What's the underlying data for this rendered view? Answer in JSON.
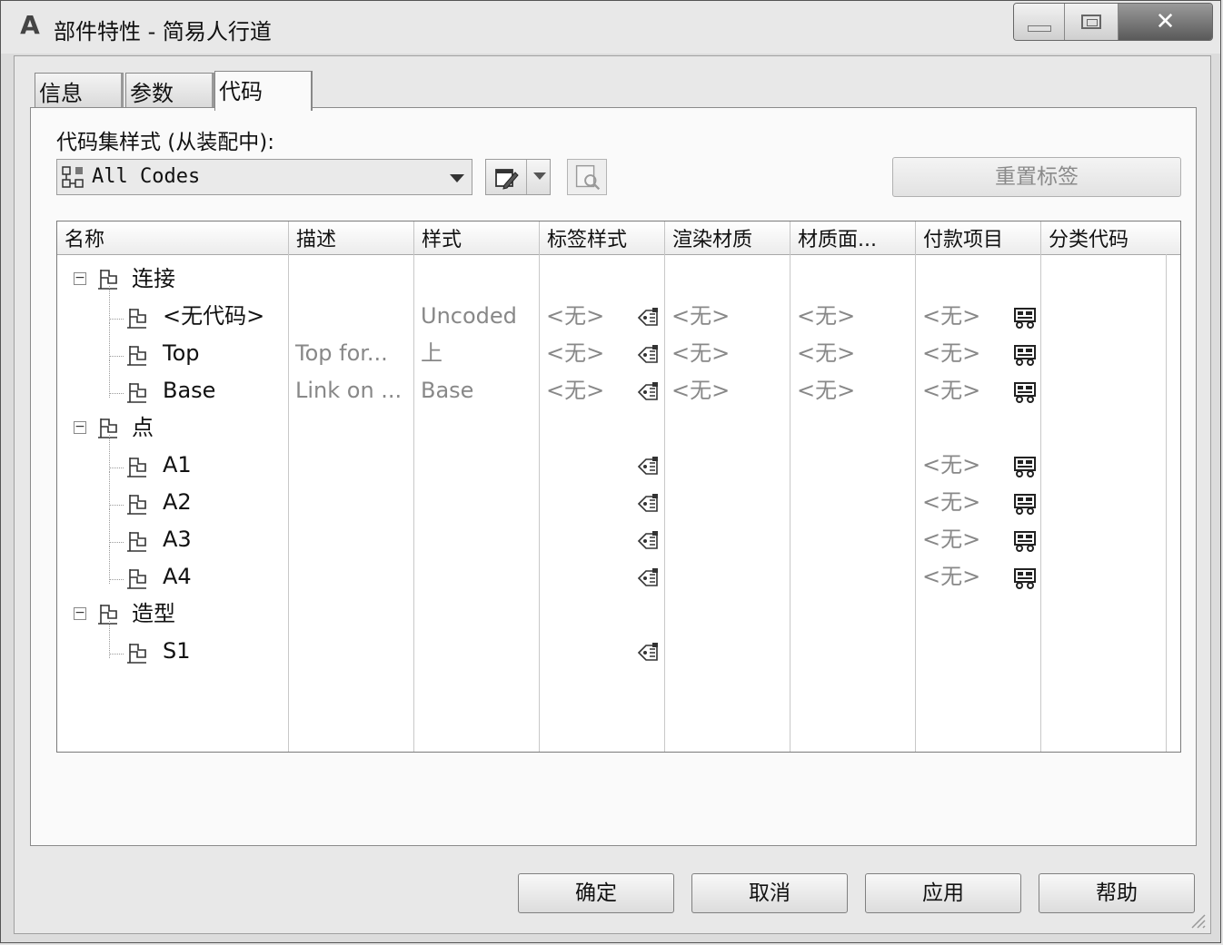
{
  "window": {
    "title": "部件特性 - 简易人行道",
    "app_icon_letter": "A"
  },
  "tabs": [
    {
      "label": "信息",
      "active": false
    },
    {
      "label": "参数",
      "active": false
    },
    {
      "label": "代码",
      "active": true
    }
  ],
  "code_set": {
    "label": "代码集样式 (从装配中):",
    "selected": "All Codes",
    "reset_labels_button": "重置标签"
  },
  "grid": {
    "columns": [
      "名称",
      "描述",
      "样式",
      "标签样式",
      "渲染材质",
      "材质面...",
      "付款项目",
      "分类代码"
    ],
    "rows": [
      {
        "level": 0,
        "name": "连接",
        "expanded": true
      },
      {
        "level": 1,
        "name": "<无代码>",
        "description": "",
        "style": "Uncoded",
        "label_style": "<无>",
        "render_material": "<无>",
        "material_area": "<无>",
        "pay_item": "<无>"
      },
      {
        "level": 1,
        "name": "Top",
        "description": "Top for...",
        "style": "上",
        "label_style": "<无>",
        "render_material": "<无>",
        "material_area": "<无>",
        "pay_item": "<无>"
      },
      {
        "level": 1,
        "name": "Base",
        "description": "Link on ...",
        "style": "Base",
        "label_style": "<无>",
        "render_material": "<无>",
        "material_area": "<无>",
        "pay_item": "<无>"
      },
      {
        "level": 0,
        "name": "点",
        "expanded": true
      },
      {
        "level": 1,
        "name": "A1",
        "pay_item": "<无>"
      },
      {
        "level": 1,
        "name": "A2",
        "pay_item": "<无>"
      },
      {
        "level": 1,
        "name": "A3",
        "pay_item": "<无>"
      },
      {
        "level": 1,
        "name": "A4",
        "pay_item": "<无>"
      },
      {
        "level": 0,
        "name": "造型",
        "expanded": true
      },
      {
        "level": 1,
        "name": "S1"
      }
    ]
  },
  "buttons": {
    "ok": "确定",
    "cancel": "取消",
    "apply": "应用",
    "help": "帮助"
  },
  "icons": {
    "expander": "minus-box-icon",
    "category": "flag-icon",
    "label_style": "label-tag-icon",
    "pay_item": "pay-item-icon"
  }
}
